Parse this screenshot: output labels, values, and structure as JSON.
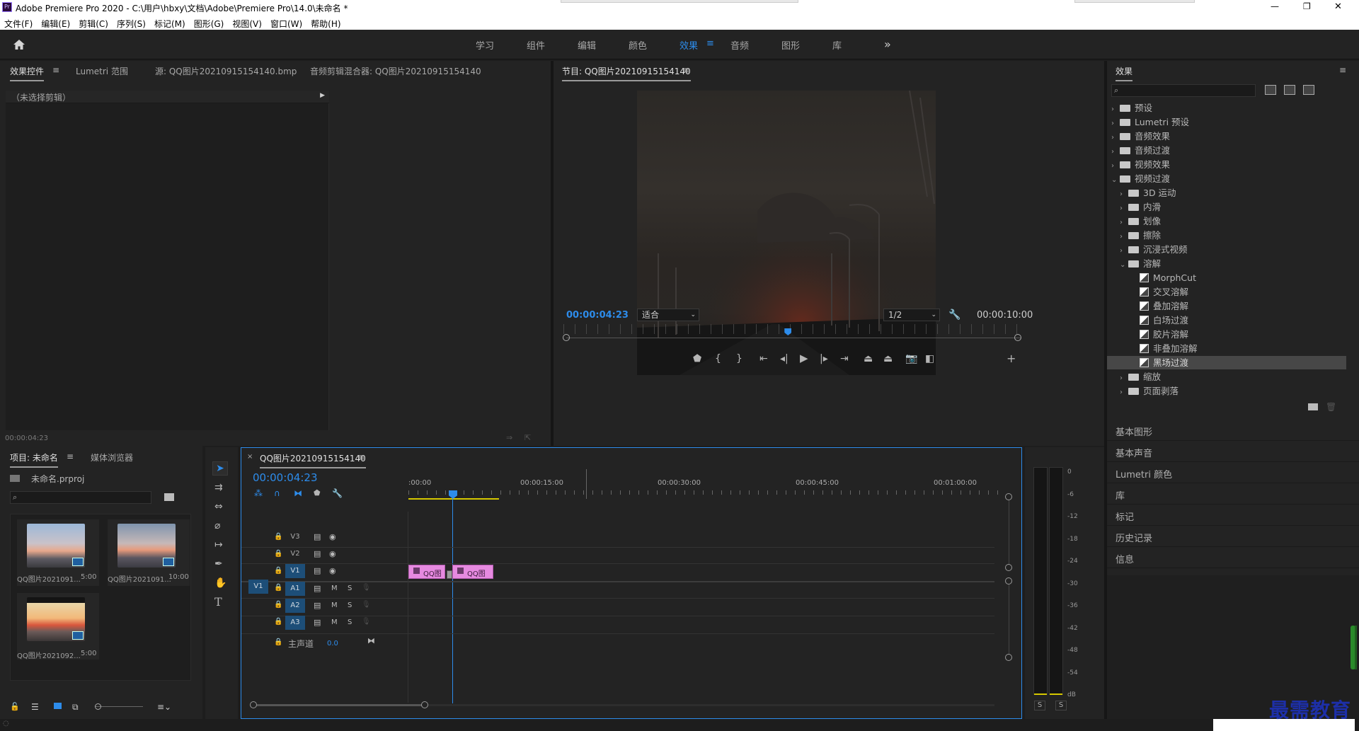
{
  "titlebar": {
    "app_icon": "Pr",
    "title": "Adobe Premiere Pro 2020 - C:\\用户\\hbxy\\文档\\Adobe\\Premiere Pro\\14.0\\未命名 *",
    "min": "—",
    "max": "❐",
    "close": "✕"
  },
  "menu": [
    "文件(F)",
    "编辑(E)",
    "剪辑(C)",
    "序列(S)",
    "标记(M)",
    "图形(G)",
    "视图(V)",
    "窗口(W)",
    "帮助(H)"
  ],
  "workspaces": {
    "items": [
      "学习",
      "组件",
      "编辑",
      "颜色",
      "效果",
      "音频",
      "图形",
      "库"
    ],
    "active": "效果",
    "more": "»"
  },
  "source_panel": {
    "tabs": [
      "效果控件",
      "Lumetri 范围",
      "源: QQ图片20210915154140.bmp",
      "音频剪辑混合器: QQ图片20210915154140"
    ],
    "no_clip": "（未选择剪辑）",
    "timecode": "00:00:04:23"
  },
  "program": {
    "title": "节目: QQ图片20210915154140",
    "timecode": "00:00:04:23",
    "fit": "适合",
    "resolution": "1/2",
    "duration": "00:00:10:00",
    "playhead_fraction": 0.488
  },
  "effects": {
    "title": "效果",
    "search_placeholder": "",
    "tree": [
      {
        "label": "预设",
        "level": 0,
        "kind": "folder",
        "open": false
      },
      {
        "label": "Lumetri 预设",
        "level": 0,
        "kind": "folder",
        "open": false
      },
      {
        "label": "音频效果",
        "level": 0,
        "kind": "folder",
        "open": false
      },
      {
        "label": "音频过渡",
        "level": 0,
        "kind": "folder",
        "open": false
      },
      {
        "label": "视频效果",
        "level": 0,
        "kind": "folder",
        "open": false
      },
      {
        "label": "视频过渡",
        "level": 0,
        "kind": "folder",
        "open": true
      },
      {
        "label": "3D 运动",
        "level": 1,
        "kind": "folder",
        "open": false
      },
      {
        "label": "内滑",
        "level": 1,
        "kind": "folder",
        "open": false
      },
      {
        "label": "划像",
        "level": 1,
        "kind": "folder",
        "open": false
      },
      {
        "label": "擦除",
        "level": 1,
        "kind": "folder",
        "open": false
      },
      {
        "label": "沉浸式视频",
        "level": 1,
        "kind": "folder",
        "open": false
      },
      {
        "label": "溶解",
        "level": 1,
        "kind": "folder",
        "open": true
      },
      {
        "label": "MorphCut",
        "level": 2,
        "kind": "fx"
      },
      {
        "label": "交叉溶解",
        "level": 2,
        "kind": "fx"
      },
      {
        "label": "叠加溶解",
        "level": 2,
        "kind": "fx"
      },
      {
        "label": "白场过渡",
        "level": 2,
        "kind": "fx"
      },
      {
        "label": "胶片溶解",
        "level": 2,
        "kind": "fx"
      },
      {
        "label": "非叠加溶解",
        "level": 2,
        "kind": "fx"
      },
      {
        "label": "黑场过渡",
        "level": 2,
        "kind": "fx",
        "selected": true
      },
      {
        "label": "缩放",
        "level": 1,
        "kind": "folder",
        "open": false
      },
      {
        "label": "页面剥落",
        "level": 1,
        "kind": "folder",
        "open": false
      }
    ]
  },
  "side_panels": [
    "基本图形",
    "基本声音",
    "Lumetri 颜色",
    "库",
    "标记",
    "历史记录",
    "信息"
  ],
  "project": {
    "tabs": [
      "项目: 未命名",
      "媒体浏览器"
    ],
    "file": "未命名.prproj",
    "items": [
      {
        "name": "QQ图片2021091...",
        "dur": "5:00"
      },
      {
        "name": "QQ图片2021091...",
        "dur": "10:00"
      },
      {
        "name": "QQ图片2021092...",
        "dur": "5:00"
      }
    ]
  },
  "timeline": {
    "tab": "QQ图片20210915154140",
    "timecode": "00:00:04:23",
    "ruler": [
      ":00:00",
      "00:00:15:00",
      "00:00:30:00",
      "00:00:45:00",
      "00:01:00:00"
    ],
    "video_tracks": [
      "V3",
      "V2",
      "V1"
    ],
    "audio_tracks": [
      "A1",
      "A2",
      "A3"
    ],
    "src_patch": "V1",
    "master_label": "主声道",
    "master_value": "0.0",
    "m": "M",
    "s": "S",
    "clips": [
      "QQ图",
      "QQ图"
    ]
  },
  "meter": {
    "scale": [
      "0",
      "-6",
      "-12",
      "-18",
      "-24",
      "-30",
      "-36",
      "-42",
      "-48",
      "-54",
      "dB"
    ],
    "solo": [
      "S",
      "S"
    ]
  },
  "watermark": "最需教育",
  "colors": {
    "accent": "#2d8ceb",
    "clip": "#e68ae0",
    "badge": "#1d4e78",
    "workarea": "#d6c800"
  }
}
